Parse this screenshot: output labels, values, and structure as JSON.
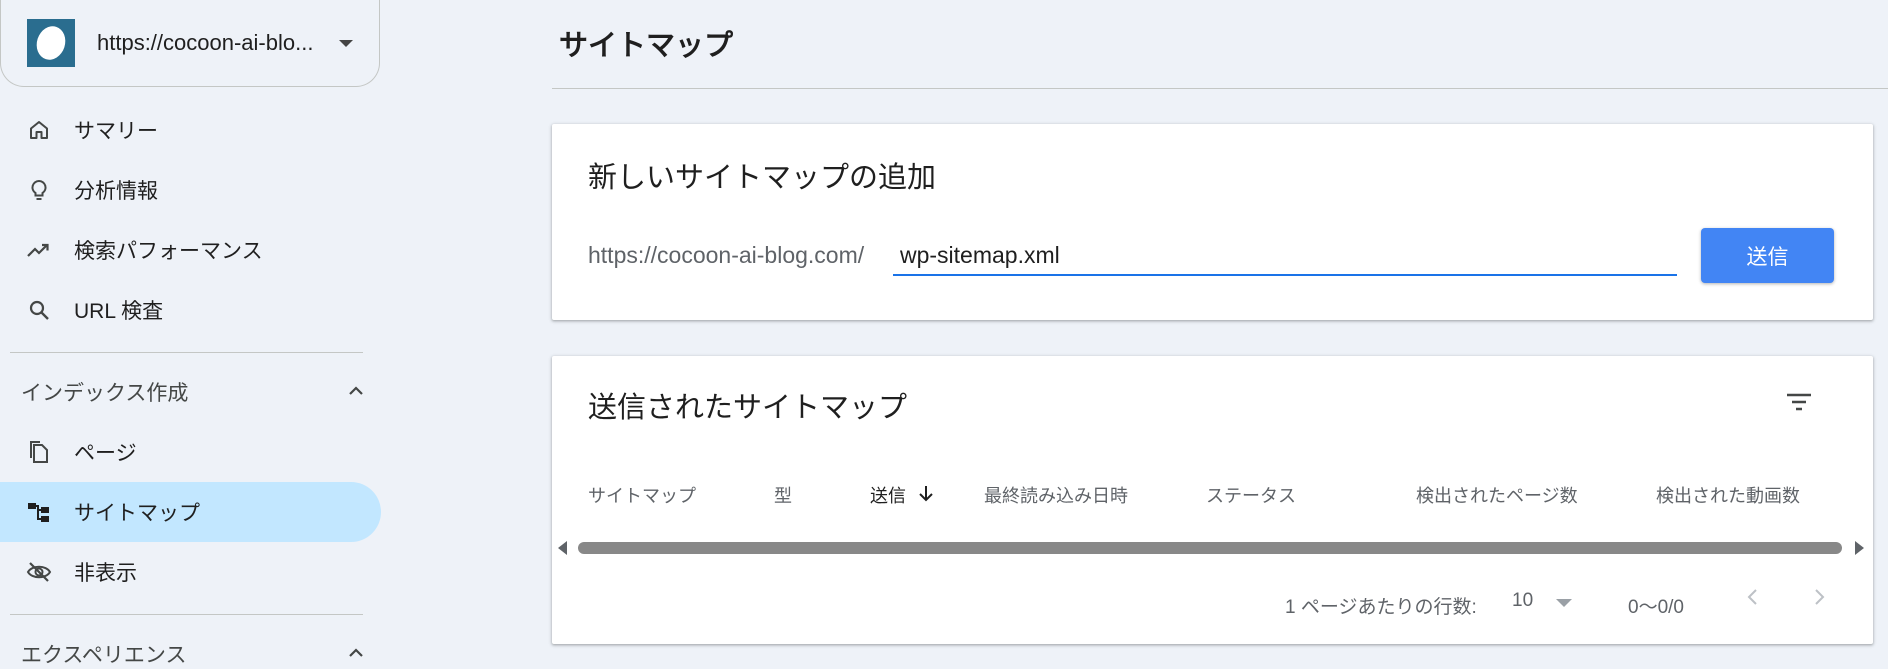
{
  "property": {
    "url": "https://cocoon-ai-blo..."
  },
  "nav": {
    "items": [
      {
        "label": "サマリー",
        "icon": "home-icon"
      },
      {
        "label": "分析情報",
        "icon": "lightbulb-icon"
      },
      {
        "label": "検索パフォーマンス",
        "icon": "trending-up-icon"
      },
      {
        "label": "URL 検査",
        "icon": "search-icon"
      }
    ],
    "index_section": {
      "label": "インデックス作成",
      "items": [
        {
          "label": "ページ",
          "icon": "pages-icon"
        },
        {
          "label": "サイトマップ",
          "icon": "sitemap-icon",
          "active": true
        },
        {
          "label": "非表示",
          "icon": "eye-off-icon"
        }
      ]
    },
    "experience_section": {
      "label": "エクスペリエンス"
    }
  },
  "main": {
    "page_title": "サイトマップ",
    "add_card": {
      "title": "新しいサイトマップの追加",
      "url_prefix": "https://cocoon-ai-blog.com/",
      "input_value": "wp-sitemap.xml",
      "submit_label": "送信"
    },
    "list_card": {
      "title": "送信されたサイトマップ",
      "columns": [
        "サイトマップ",
        "型",
        "送信",
        "最終読み込み日時",
        "ステータス",
        "検出されたページ数",
        "検出された動画数"
      ],
      "sorted_column": "送信",
      "pager": {
        "rows_label": "1 ページあたりの行数:",
        "rows_value": "10",
        "range": "0〜0/0"
      }
    }
  },
  "colors": {
    "accent": "#1a73e8",
    "button": "#4285f4",
    "active_nav": "#c2e7ff",
    "background": "#eef2f8"
  }
}
